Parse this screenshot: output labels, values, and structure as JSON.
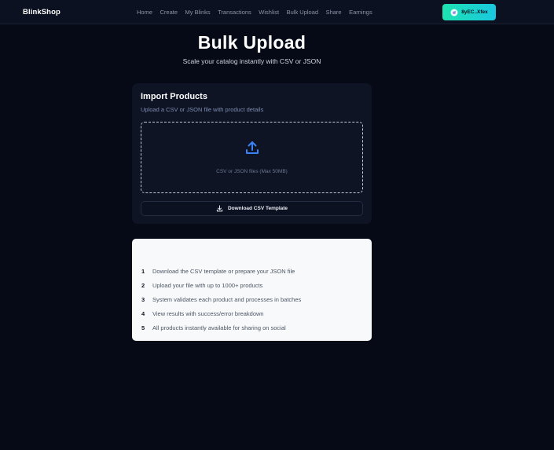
{
  "brand": "BlinkShop",
  "nav": {
    "links": [
      "Home",
      "Create",
      "My Blinks",
      "Transactions",
      "Wishlist",
      "Bulk Upload",
      "Share",
      "Earnings"
    ]
  },
  "wallet": {
    "label": "8yEC..Xfex",
    "icon": "wallet-icon"
  },
  "header": {
    "title": "Bulk Upload",
    "subtitle": "Scale your catalog instantly with CSV or JSON"
  },
  "import": {
    "title": "Import Products",
    "subtitle": "Upload a CSV or JSON file with product details",
    "dropzone_hint": "CSV or JSON files (Max 50MB)",
    "dropzone_icon": "upload-icon",
    "template_button": "Download CSV Template",
    "template_icon": "download-icon"
  },
  "steps": [
    {
      "num": "1",
      "text": "Download the CSV template or prepare your JSON file"
    },
    {
      "num": "2",
      "text": "Upload your file with up to 1000+ products"
    },
    {
      "num": "3",
      "text": "System validates each product and processes in batches"
    },
    {
      "num": "4",
      "text": "View results with success/error breakdown"
    },
    {
      "num": "5",
      "text": "All products instantly available for sharing on social"
    }
  ],
  "colors": {
    "background": "#050a16",
    "accent_start": "#1ee3b0",
    "accent_end": "#19c7e0",
    "upload_icon": "#3b82f6"
  }
}
